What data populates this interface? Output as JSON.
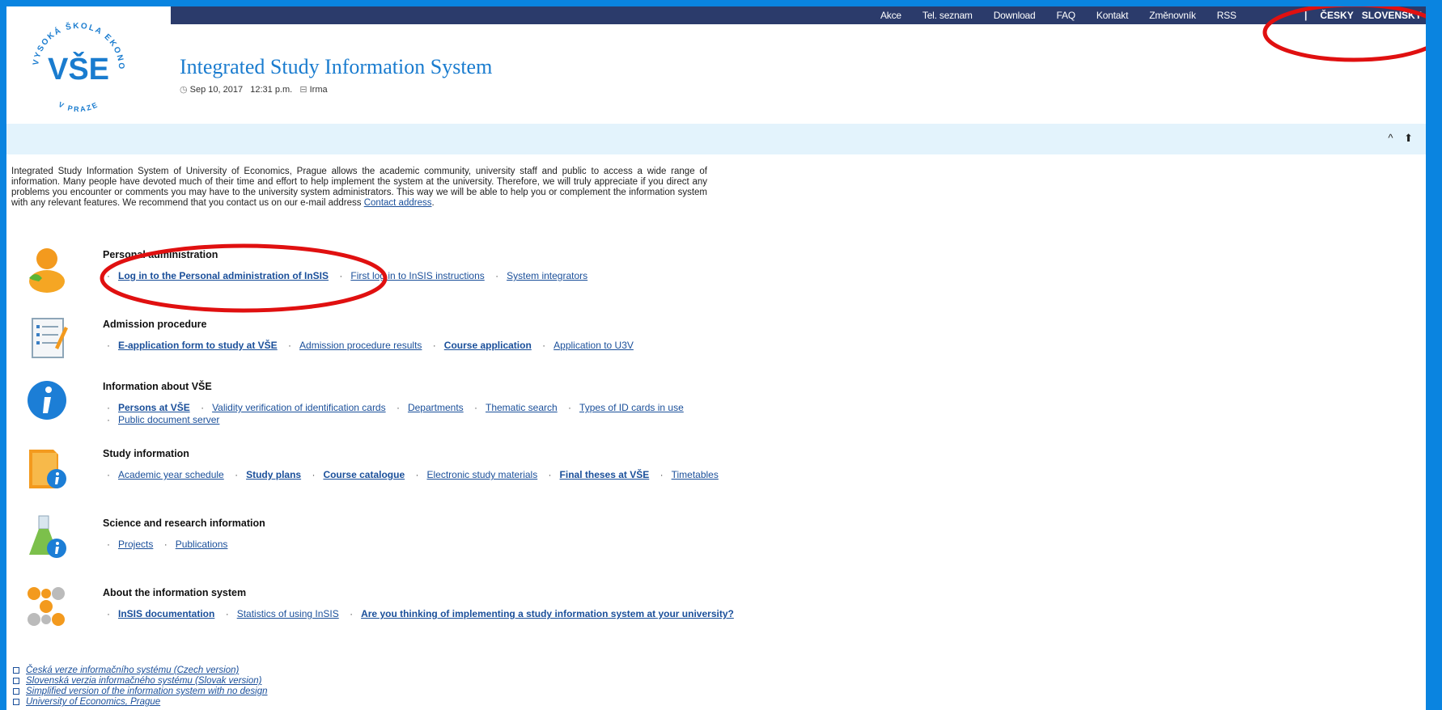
{
  "topnav": [
    "Akce",
    "Tel. seznam",
    "Download",
    "FAQ",
    "Kontakt",
    "Změnovník",
    "RSS"
  ],
  "lang": {
    "sep": "|",
    "cz": "ČESKY",
    "sk": "SLOVENSKY"
  },
  "logo": {
    "text_top": "VYSOKÁ ŠKOLA EKONOMICKÁ",
    "text_bottom": "V PRAZE",
    "mark": "VŠE"
  },
  "header": {
    "title": "Integrated Study Information System",
    "date": "Sep 10, 2017",
    "time": "12:31 p.m.",
    "user": "Irma"
  },
  "subbar": {
    "up": "^",
    "home": "⬆"
  },
  "intro": {
    "text": "Integrated Study Information System of University of Economics, Prague allows the academic community, university staff and public to access a wide range of information. Many people have devoted much of their time and effort to help implement the system at the university. Therefore, we will truly appreciate if you direct any problems you encounter or comments you may have to the university system administrators. This way we will be able to help you or complement the information system with any relevant features. We recommend that you contact us on our e-mail address ",
    "link": "Contact address",
    "end": "."
  },
  "sections": [
    {
      "title": "Personal administration",
      "links": [
        {
          "text": "Log in to the Personal administration of InSIS",
          "bold": true
        },
        {
          "text": "First log in to InSIS instructions",
          "bold": false
        },
        {
          "text": "System integrators",
          "bold": false
        }
      ]
    },
    {
      "title": "Admission procedure",
      "links": [
        {
          "text": "E-application form to study at VŠE",
          "bold": true
        },
        {
          "text": "Admission procedure results",
          "bold": false
        },
        {
          "text": "Course application",
          "bold": true
        },
        {
          "text": "Application to U3V",
          "bold": false
        }
      ]
    },
    {
      "title": "Information about VŠE",
      "links": [
        {
          "text": "Persons at VŠE",
          "bold": true
        },
        {
          "text": "Validity verification of identification cards",
          "bold": false
        },
        {
          "text": "Departments",
          "bold": false
        },
        {
          "text": "Thematic search",
          "bold": false
        },
        {
          "text": "Types of ID cards in use",
          "bold": false
        }
      ],
      "links2": [
        {
          "text": "Public document server",
          "bold": false
        }
      ]
    },
    {
      "title": "Study information",
      "links": [
        {
          "text": "Academic year schedule",
          "bold": false
        },
        {
          "text": "Study plans",
          "bold": true
        },
        {
          "text": "Course catalogue",
          "bold": true
        },
        {
          "text": "Electronic study materials",
          "bold": false
        },
        {
          "text": "Final theses at VŠE",
          "bold": true
        },
        {
          "text": "Timetables",
          "bold": false
        }
      ]
    },
    {
      "title": "Science and research information",
      "links": [
        {
          "text": "Projects",
          "bold": false
        },
        {
          "text": "Publications",
          "bold": false
        }
      ]
    },
    {
      "title": "About the information system",
      "links": [
        {
          "text": "InSIS documentation",
          "bold": true
        },
        {
          "text": "Statistics of using InSIS",
          "bold": false
        },
        {
          "text": "Are you thinking of implementing a study information system at your university?",
          "bold": true
        }
      ]
    }
  ],
  "footer": [
    "Česká verze informačního systému (Czech version)",
    "Slovenská verzia informačného systému (Slovak version)",
    "Simplified version of the information system with no design",
    "University of Economics, Prague"
  ]
}
